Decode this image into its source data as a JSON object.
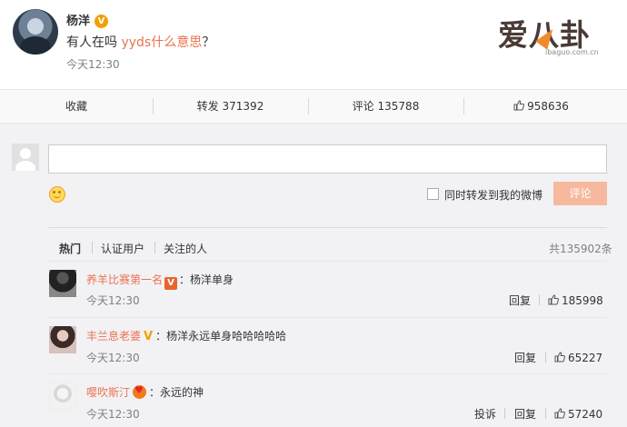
{
  "post": {
    "username": "杨洋",
    "verified_mark": "V",
    "text_before": "有人在吗 ",
    "text_link": "yyds什么意思",
    "text_after": "？",
    "time": "今天12:30"
  },
  "brand": {
    "main": "爱八卦",
    "sub": "ibaguo.com.cn"
  },
  "actions": {
    "collect": "收藏",
    "forward_label": "转发",
    "forward_count": "371392",
    "comment_label": "评论",
    "comment_count": "135788",
    "like_count": "958636"
  },
  "composer": {
    "input_value": "",
    "repost_label": "同时转发到我的微博",
    "submit_label": "评论"
  },
  "tabs": {
    "hot": "热门",
    "verified": "认证用户",
    "following": "关注的人",
    "total": "共135902条"
  },
  "comments": [
    {
      "name": "养羊比赛第一名",
      "badge": "V",
      "text": "：杨洋单身",
      "time": "今天12:30",
      "reply": "回复",
      "likes": "185998"
    },
    {
      "name": "丰兰息老婆",
      "badge": "V",
      "text": "：杨洋永远单身哈哈哈哈哈",
      "time": "今天12:30",
      "reply": "回复",
      "likes": "65227"
    },
    {
      "name": "嘤吹斯汀",
      "text": "：永远的神",
      "time": "今天12:30",
      "report": "投诉",
      "reply": "回复",
      "likes": "57240"
    }
  ],
  "colors": {
    "accent": "#eb7350",
    "submit_bg": "#f7b99d",
    "verified_gold": "#f0a000"
  }
}
